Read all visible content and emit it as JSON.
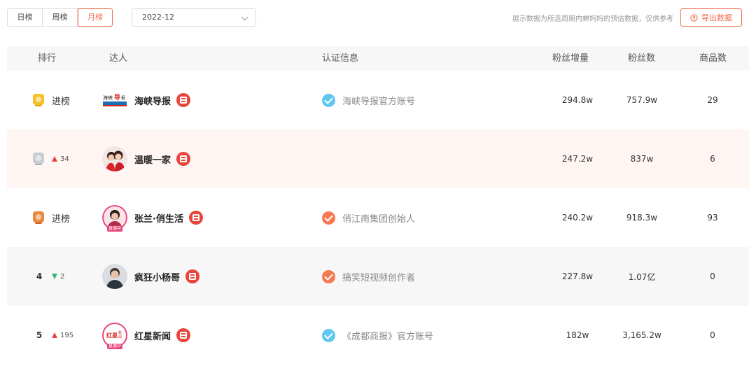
{
  "toolbar": {
    "tabs": [
      {
        "label": "日榜",
        "active": false
      },
      {
        "label": "周榜",
        "active": false
      },
      {
        "label": "月榜",
        "active": true
      }
    ],
    "date_value": "2022-12",
    "note": "展示数据为所选周期内蝉妈妈的预估数据，仅供参考",
    "export_label": "导出数据",
    "accent_color": "#f26b4e"
  },
  "table": {
    "headers": {
      "rank": "排行",
      "influencer": "达人",
      "verify": "认证信息",
      "fan_increase": "粉丝增量",
      "fans": "粉丝数",
      "goods": "商品数"
    },
    "rows": [
      {
        "rank_type": "medal-gold",
        "rank_text": "进榜",
        "trend": "",
        "trend_value": "",
        "name": "海峡导报",
        "avatar": "haixia-logo",
        "verify_icon": "blue",
        "verify": "海峡导报官方账号",
        "fan_increase": "294.8w",
        "fans": "757.9w",
        "goods": "29"
      },
      {
        "rank_type": "medal-silver",
        "rank_text": "",
        "trend": "up",
        "trend_value": "34",
        "name": "温暖一家",
        "avatar": "couple-photo",
        "verify_icon": "",
        "verify": "",
        "fan_increase": "247.2w",
        "fans": "837w",
        "goods": "6"
      },
      {
        "rank_type": "medal-bronze",
        "rank_text": "进榜",
        "trend": "",
        "trend_value": "",
        "name": "张兰·俏生活",
        "avatar": "woman-photo-live",
        "verify_icon": "orange",
        "verify": "俏江南集团创始人",
        "fan_increase": "240.2w",
        "fans": "918.3w",
        "goods": "93"
      },
      {
        "rank_type": "number",
        "rank_text": "4",
        "trend": "down",
        "trend_value": "2",
        "name": "疯狂小杨哥",
        "avatar": "man-photo",
        "verify_icon": "orange",
        "verify": "搞笑短视频创作者",
        "fan_increase": "227.8w",
        "fans": "1.07亿",
        "goods": "0"
      },
      {
        "rank_type": "number",
        "rank_text": "5",
        "trend": "up",
        "trend_value": "195",
        "name": "红星新闻",
        "avatar": "hongxing-logo-live",
        "verify_icon": "blue",
        "verify": "《成都商报》官方账号",
        "fan_increase": "182w",
        "fans": "3,165.2w",
        "goods": "0"
      }
    ],
    "live_tag": "直播中"
  }
}
